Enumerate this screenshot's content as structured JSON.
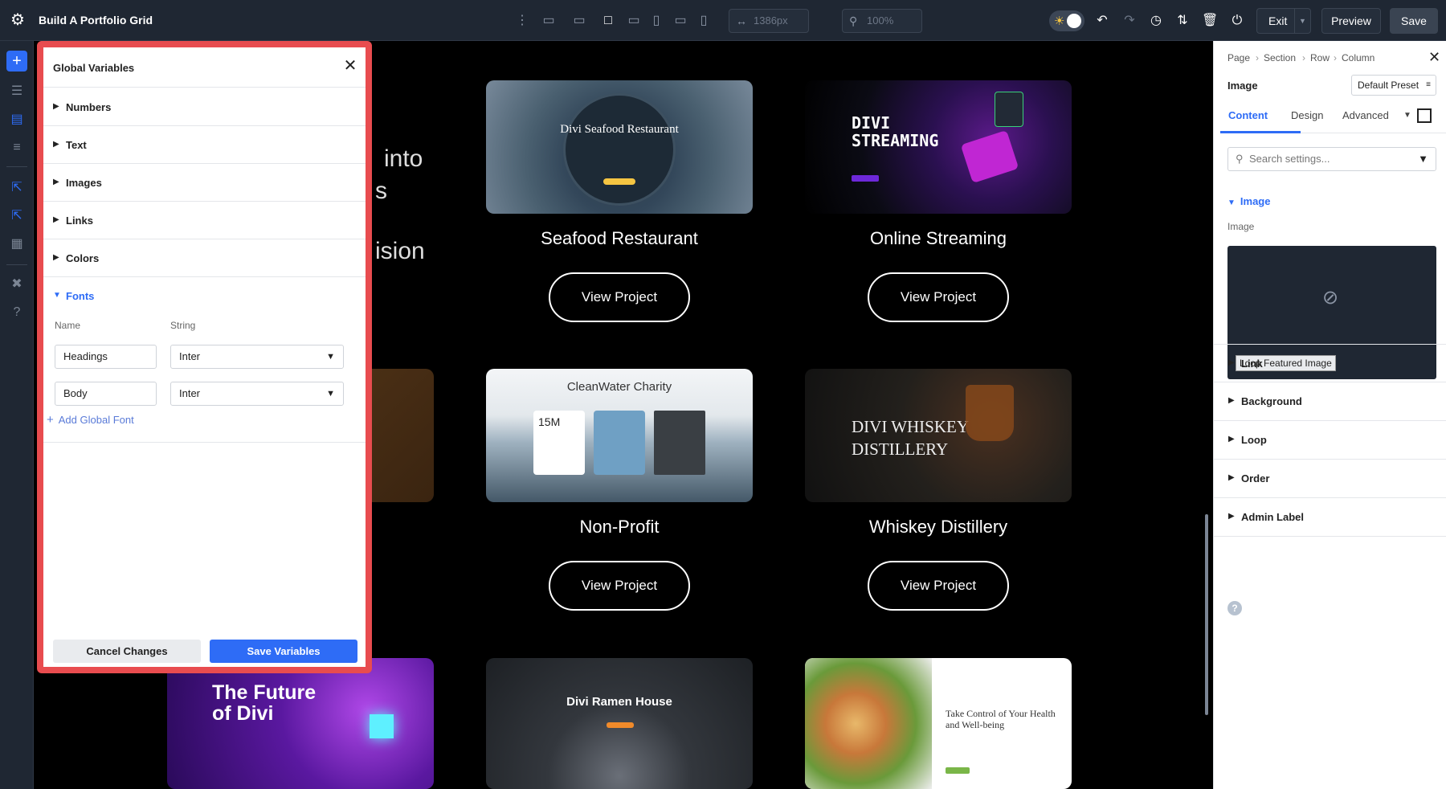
{
  "topbar": {
    "title": "Build A Portfolio Grid",
    "width_value": "1386px",
    "zoom_value": "100%",
    "exit_label": "Exit",
    "preview_label": "Preview",
    "save_label": "Save"
  },
  "canvas": {
    "bg_text_1": "into",
    "bg_text_2": "s",
    "bg_text_3": "ision",
    "cards": [
      {
        "title": "Seafood Restaurant",
        "thumb_text": "Divi Seafood Restaurant",
        "button": "View Project"
      },
      {
        "title": "Online Streaming",
        "thumb_text": "DIVI STREAMING",
        "button": "View Project"
      },
      {
        "title": "Non-Profit",
        "thumb_text": "CleanWater Charity",
        "thumb_stat": "15M",
        "button": "View Project"
      },
      {
        "title": "Whiskey Distillery",
        "thumb_text": "DIVI WHISKEY DISTILLERY",
        "button": "View Project"
      },
      {
        "thumb_text": "The Future of Divi"
      },
      {
        "thumb_text": "Divi Ramen House"
      },
      {
        "thumb_text": "Take Control of Your Health and Well-being"
      }
    ]
  },
  "global_variables": {
    "title": "Global Variables",
    "sections": [
      {
        "label": "Numbers"
      },
      {
        "label": "Text"
      },
      {
        "label": "Images"
      },
      {
        "label": "Links"
      },
      {
        "label": "Colors"
      },
      {
        "label": "Fonts"
      }
    ],
    "col_name": "Name",
    "col_string": "String",
    "fonts": [
      {
        "name": "Headings",
        "value": "Inter"
      },
      {
        "name": "Body",
        "value": "Inter"
      }
    ],
    "add_font_label": "Add Global Font",
    "cancel_label": "Cancel Changes",
    "save_label": "Save Variables"
  },
  "right_panel": {
    "breadcrumb": [
      "Page",
      "Section",
      "Row",
      "Column"
    ],
    "module_label": "Image",
    "preset_label": "Default Preset",
    "tabs": [
      "Content",
      "Design",
      "Advanced"
    ],
    "search_placeholder": "Search settings...",
    "image_section_label": "Image",
    "image_field_label": "Image",
    "loop_label": "Loop Featured Image",
    "sections": [
      {
        "label": "Link"
      },
      {
        "label": "Background"
      },
      {
        "label": "Loop"
      },
      {
        "label": "Order"
      },
      {
        "label": "Admin Label"
      }
    ]
  },
  "colors": {
    "accent": "#2e6cf6",
    "highlight_border": "#e84c4f",
    "topbar_bg": "#1f2733"
  }
}
